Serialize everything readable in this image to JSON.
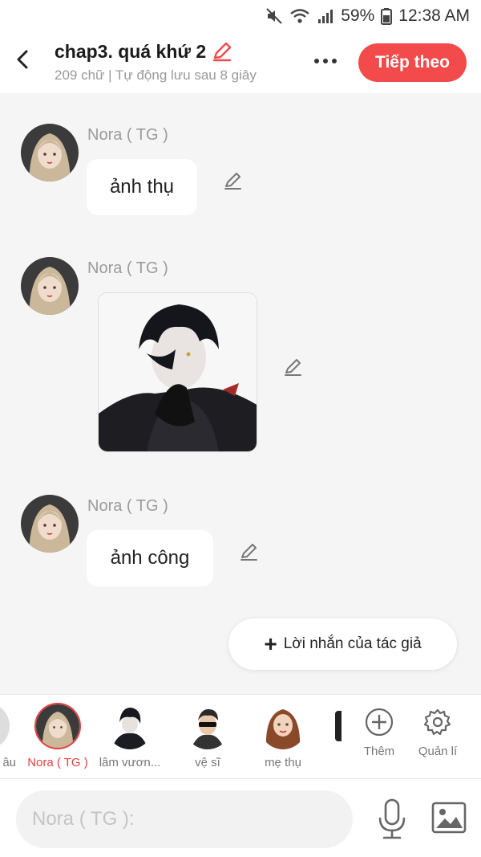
{
  "status_bar": {
    "battery": "59%",
    "time": "12:38 AM",
    "icons": [
      "mute-icon",
      "wifi-icon",
      "signal-icon",
      "battery-icon"
    ]
  },
  "header": {
    "title": "chap3. quá khứ 2",
    "subtitle": "209 chữ | Tự động lưu sau 8 giây",
    "next_label": "Tiếp theo",
    "accent_color": "#f34b4b"
  },
  "messages": [
    {
      "sender": "Nora ( TG )",
      "type": "text",
      "text": "ảnh thụ"
    },
    {
      "sender": "Nora ( TG )",
      "type": "image",
      "text": ""
    },
    {
      "sender": "Nora ( TG )",
      "type": "text",
      "text": "ảnh công"
    }
  ],
  "author_note": {
    "label": "Lời nhắn của tác giả"
  },
  "characters": [
    {
      "name": "âu"
    },
    {
      "name": "Nora ( TG )",
      "active": true
    },
    {
      "name": "lâm vươn..."
    },
    {
      "name": "vệ sĩ"
    },
    {
      "name": "mẹ thụ"
    }
  ],
  "tools": {
    "add_label": "Thêm",
    "manage_label": "Quản lí"
  },
  "composer": {
    "placeholder": "Nora ( TG ):"
  }
}
